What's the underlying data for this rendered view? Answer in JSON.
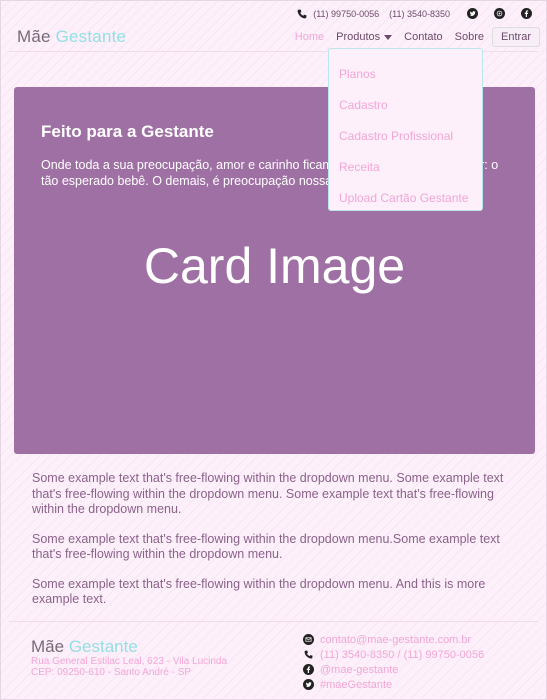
{
  "topbar": {
    "phone_mobile": "(11) 99750-0056",
    "phone_landline": "(11) 3540-8350",
    "icons": [
      "phone-icon",
      "twitter-icon",
      "whatsapp-icon",
      "facebook-icon"
    ]
  },
  "brand": {
    "part1": "Mãe",
    "part2": "Gestante"
  },
  "nav": {
    "home": "Home",
    "produtos": "Produtos",
    "contato": "Contato",
    "sobre": "Sobre",
    "entrar": "Entrar"
  },
  "dropdown": {
    "items": [
      "Planos",
      "Cadastro",
      "Cadastro Profissional",
      "Receita",
      "Upload Cartão Gestante"
    ]
  },
  "card": {
    "title": "Feito para a Gestante",
    "text": "Onde toda a sua preocupação, amor e carinho ficam para quem você mais quer: o tão esperado bebê. O demais, é preocupação nossa.",
    "image_label": "Card Image"
  },
  "texts": [
    "Some example text that's free-flowing within the dropdown menu. Some example text that's free-flowing within the dropdown menu. Some example text that's free-flowing within the dropdown menu.",
    "Some example text that's free-flowing within the dropdown menu.Some example text that's free-flowing within the dropdown menu.",
    "Some example text that's free-flowing within the dropdown menu. And this is more example text."
  ],
  "footer": {
    "brand1": "Mãe",
    "brand2": "Gestante",
    "address_line1": "Rua General Estilac Leal, 623 - Vila Lucinda",
    "address_line2": "CEP: 09250-610 - Santo André - SP",
    "email": "contato@mae-gestante.com.br",
    "phones": "(11) 3540-8350 / (11) 99750-0056",
    "facebook": "@mae-gestante",
    "twitter": "#maeGestante"
  },
  "colors": {
    "background": "#fdf0fb",
    "card": "#9f70a3",
    "accent_pink": "#f2a6d4",
    "accent_teal": "#93e0e4"
  }
}
